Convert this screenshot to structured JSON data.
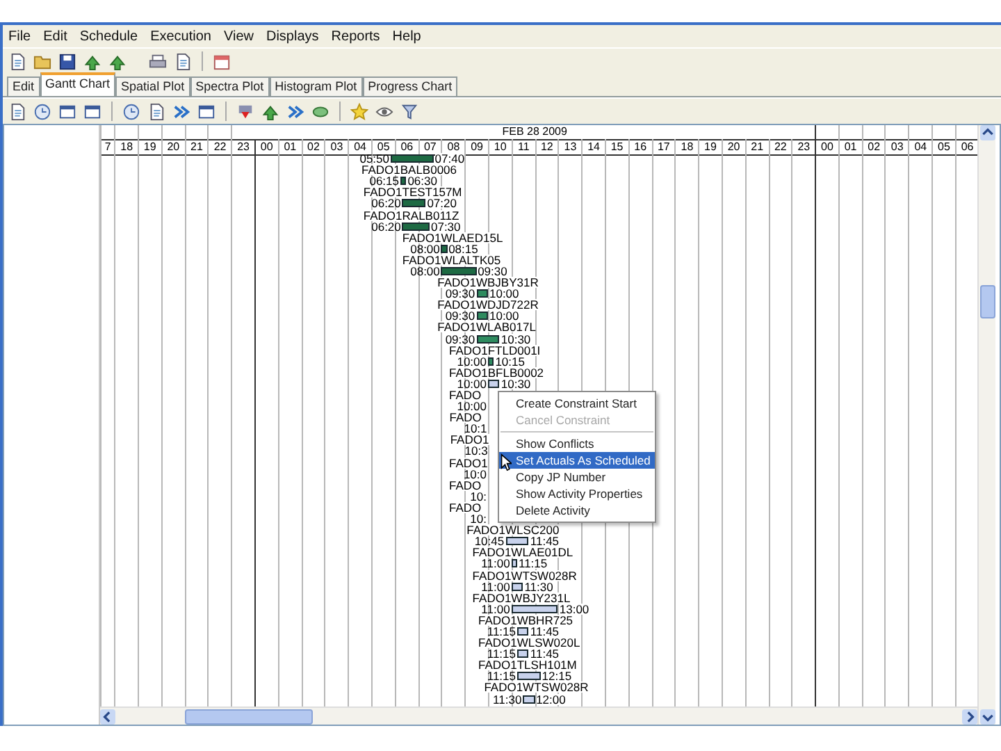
{
  "menu_bar": [
    "File",
    "Edit",
    "Schedule",
    "Execution",
    "View",
    "Displays",
    "Reports",
    "Help"
  ],
  "tabs": [
    {
      "label": "Edit",
      "selected": false
    },
    {
      "label": "Gantt Chart",
      "selected": true
    },
    {
      "label": "Spatial Plot",
      "selected": false
    },
    {
      "label": "Spectra Plot",
      "selected": false
    },
    {
      "label": "Histogram Plot",
      "selected": false
    },
    {
      "label": "Progress Chart",
      "selected": false
    }
  ],
  "timeline": {
    "day_label": "FEB 28 2009",
    "hours": [
      "7",
      "18",
      "19",
      "20",
      "21",
      "22",
      "23",
      "00",
      "01",
      "02",
      "03",
      "04",
      "05",
      "06",
      "07",
      "08",
      "09",
      "10",
      "11",
      "12",
      "13",
      "14",
      "15",
      "16",
      "17",
      "18",
      "19",
      "20",
      "21",
      "22",
      "23",
      "00",
      "01",
      "02",
      "03",
      "04",
      "05",
      "06"
    ]
  },
  "tasks": [
    {
      "start": "05:50",
      "end": "07:40",
      "color": "#1d6a43"
    },
    {
      "name": "FADO1BALB0006",
      "start": "06:15",
      "end": "06:30",
      "color": "#1d6a43"
    },
    {
      "name": "FADO1TEST157M",
      "start": "06:20",
      "end": "07:20",
      "color": "#1d6a43"
    },
    {
      "name": "FADO1RALB011Z",
      "start": "06:20",
      "end": "07:30",
      "color": "#1d6a43"
    },
    {
      "name": "FADO1WLAED15L",
      "start": "08:00",
      "end": "08:15",
      "color": "#1d6a43"
    },
    {
      "name": "FADO1WLALTK05",
      "start": "08:00",
      "end": "09:30",
      "color": "#1d6a43"
    },
    {
      "name": "FADO1WBJBY31R",
      "start": "09:30",
      "end": "10:00",
      "color": "#2e8b5f"
    },
    {
      "name": "FADO1WDJD722R",
      "start": "09:30",
      "end": "10:00",
      "color": "#2e8b5f"
    },
    {
      "name": "FADO1WLAB017L",
      "start": "09:30",
      "end": "10:30",
      "color": "#2e8b5f"
    },
    {
      "name": "FADO1FTLD001I",
      "start": "10:00",
      "end": "10:15",
      "color": "#2e8b5f"
    },
    {
      "name": "FADO1BFLB0002",
      "start": "10:00",
      "end": "10:30",
      "color": "#c8d2ec"
    },
    {
      "name": "FADO",
      "start": "10:00"
    },
    {
      "name": "FADO",
      "start": "10:1"
    },
    {
      "name": "FADO1",
      "start": "10:3"
    },
    {
      "name": "FADO1",
      "start": "10:0"
    },
    {
      "name": "FADO",
      "start": "10:"
    },
    {
      "name": "FADO",
      "start": "10:"
    },
    {
      "name": "FADO1WLSC200",
      "start": "10:45",
      "end": "11:45",
      "color": "#c8d2ec"
    },
    {
      "name": "FADO1WLAE01DL",
      "start": "11:00",
      "end": "11:15",
      "color": "#c8d2ec"
    },
    {
      "name": "FADO1WTSW028R",
      "start": "11:00",
      "end": "11:30",
      "color": "#c8d2ec"
    },
    {
      "name": "FADO1WBJY231L",
      "start": "11:00",
      "end": "13:00",
      "color": "#c8d2ec"
    },
    {
      "name": "FADO1WBHR725",
      "start": "11:15",
      "end": "11:45",
      "color": "#c8d2ec"
    },
    {
      "name": "FADO1WLSW020L",
      "start": "11:15",
      "end": "11:45",
      "color": "#c8d2ec"
    },
    {
      "name": "FADO1TLSH101M",
      "start": "11:15",
      "end": "12:15",
      "color": "#c8d2ec"
    },
    {
      "name": "FADO1WTSW028R",
      "start": "11:30",
      "end": "12:00",
      "color": "#c8d2ec"
    }
  ],
  "context_menu": [
    {
      "kind": "item",
      "label": "Create Constraint Start",
      "disabled": false,
      "selected": false
    },
    {
      "kind": "item",
      "label": "Cancel Constraint",
      "disabled": true,
      "selected": false
    },
    {
      "kind": "separator"
    },
    {
      "kind": "item",
      "label": "Show Conflicts",
      "disabled": false,
      "selected": false
    },
    {
      "kind": "item",
      "label": "Set Actuals As Scheduled",
      "disabled": false,
      "selected": true
    },
    {
      "kind": "item",
      "label": "Copy JP Number",
      "disabled": false,
      "selected": false
    },
    {
      "kind": "item",
      "label": "Show Activity Properties",
      "disabled": false,
      "selected": false
    },
    {
      "kind": "item",
      "label": "Delete Activity",
      "disabled": false,
      "selected": false
    }
  ]
}
